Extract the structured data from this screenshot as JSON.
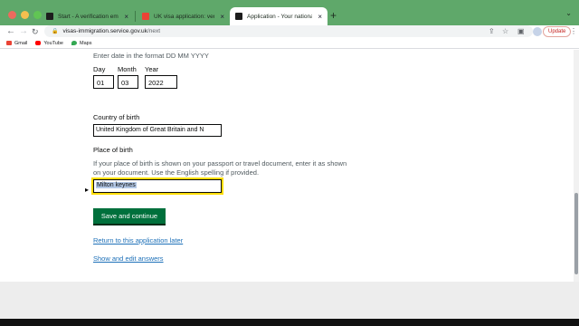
{
  "browser": {
    "tabs": [
      {
        "title": "Start - A verification email has",
        "active": false
      },
      {
        "title": "UK visa application: verify your",
        "active": false
      },
      {
        "title": "Application - Your nationality, ide",
        "active": true
      }
    ],
    "new_tab": "+",
    "tab_close": "×",
    "url_host": "visas-immigration.service.gov.uk",
    "url_path": "/next",
    "update_label": "Update",
    "bookmarks": [
      {
        "label": "Gmail",
        "icon": "gmail-icon"
      },
      {
        "label": "YouTube",
        "icon": "youtube-icon"
      },
      {
        "label": "Maps",
        "icon": "maps-icon"
      }
    ]
  },
  "form": {
    "date_hint": "Enter date in the format DD MM YYYY",
    "date_labels": {
      "day": "Day",
      "month": "Month",
      "year": "Year"
    },
    "date_values": {
      "day": "01",
      "month": "03",
      "year": "2022"
    },
    "country_label": "Country of birth",
    "country_value": "United Kingdom of Great Britain and N",
    "place_label": "Place of birth",
    "place_hint_line1": "If your place of birth is shown on your passport or travel document, enter it as shown",
    "place_hint_line2": "on your document. Use the English spelling if provided.",
    "place_value": "Milton keynes",
    "save_button": "Save and continue",
    "return_link": "Return to this application later",
    "show_link": "Show and edit answers"
  },
  "colors": {
    "tab_strip": "#5fa86a",
    "save_button": "#00703c",
    "link": "#1d70b8",
    "focus": "#ffdd00"
  }
}
